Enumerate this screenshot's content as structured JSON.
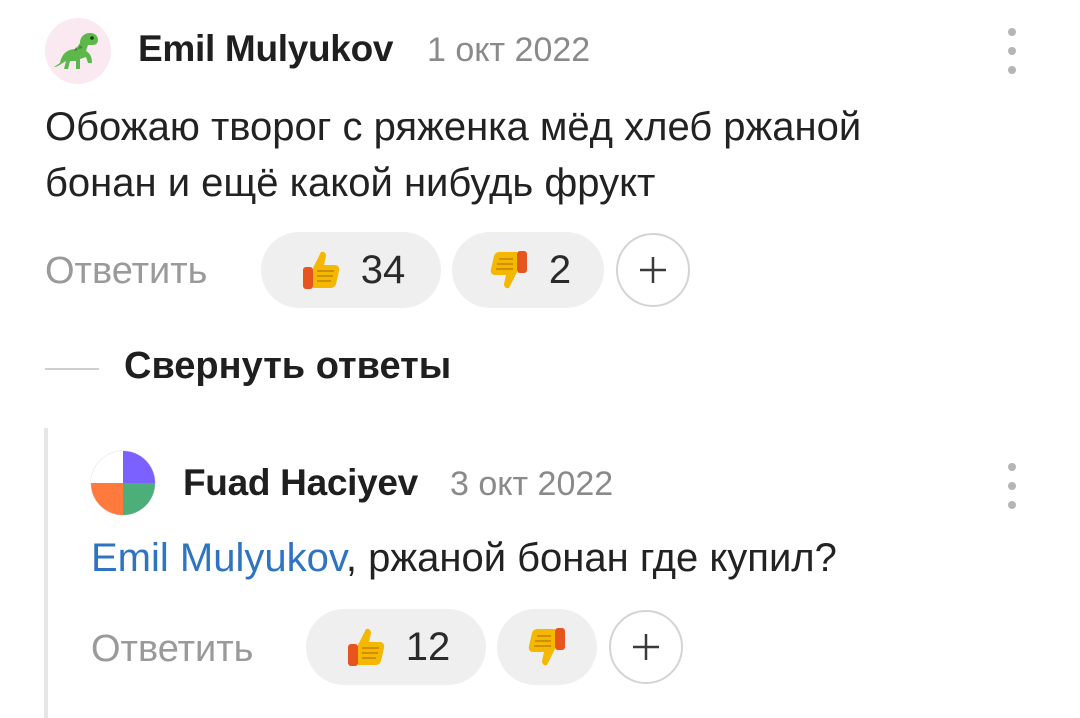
{
  "comments": [
    {
      "author": "Emil Mulyukov",
      "date": "1 окт 2022",
      "avatar_icon": "dinosaur-icon",
      "text_lines": [
        "Обожаю творог с ряженка мёд хлеб ржаной",
        "бонан и ещё какой нибудь фрукт"
      ],
      "reply_label": "Ответить",
      "likes": "34",
      "dislikes": "2",
      "add_reaction": "+"
    }
  ],
  "collapse_label": "Свернуть ответы",
  "replies": [
    {
      "author": "Fuad Haciyev",
      "date": "3 окт 2022",
      "avatar_icon": "four-petal-avatar-icon",
      "mention": "Emil Mulyukov",
      "text": ", ржаной бонан где купил?",
      "reply_label": "Ответить",
      "likes": "12",
      "dislikes": "",
      "add_reaction": "+"
    }
  ],
  "colors": {
    "mention": "#2f74c0",
    "thumb_yellow": "#f5b800",
    "thumb_orange": "#e8541e",
    "avatar_purple": "#7b61ff",
    "avatar_green": "#4caf7a",
    "avatar_orange": "#ff7a3c"
  }
}
